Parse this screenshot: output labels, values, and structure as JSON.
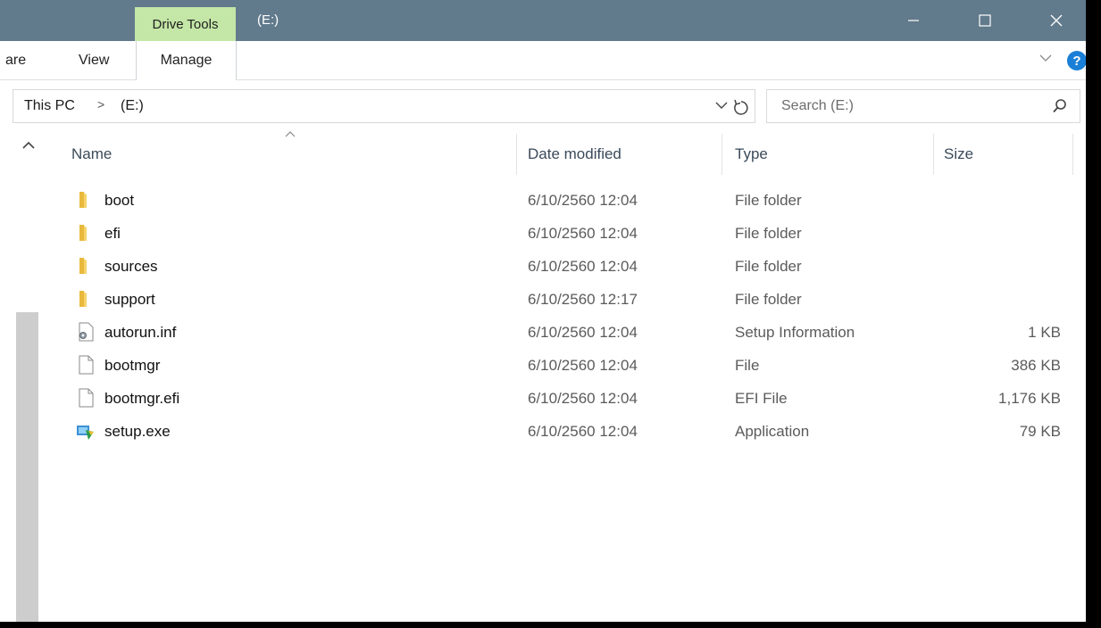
{
  "titlebar": {
    "context_tab": "Drive Tools",
    "title": "(E:)",
    "bg_color": "#617a8c",
    "context_color": "#c4e6a7"
  },
  "ribbon": {
    "tabs": [
      {
        "label": "are"
      },
      {
        "label": "View"
      },
      {
        "label": "Manage"
      }
    ]
  },
  "address": {
    "crumbs": [
      "This PC",
      "(E:)"
    ]
  },
  "search": {
    "placeholder": "Search (E:)"
  },
  "columns": {
    "name": "Name",
    "date": "Date modified",
    "type": "Type",
    "size": "Size"
  },
  "files": [
    {
      "name": "boot",
      "date": "6/10/2560 12:04",
      "type": "File folder",
      "size": "",
      "icon": "folder-icon"
    },
    {
      "name": "efi",
      "date": "6/10/2560 12:04",
      "type": "File folder",
      "size": "",
      "icon": "folder-icon"
    },
    {
      "name": "sources",
      "date": "6/10/2560 12:04",
      "type": "File folder",
      "size": "",
      "icon": "folder-icon"
    },
    {
      "name": "support",
      "date": "6/10/2560 12:17",
      "type": "File folder",
      "size": "",
      "icon": "folder-icon"
    },
    {
      "name": "autorun.inf",
      "date": "6/10/2560 12:04",
      "type": "Setup Information",
      "size": "1 KB",
      "icon": "setup-info-icon"
    },
    {
      "name": "bootmgr",
      "date": "6/10/2560 12:04",
      "type": "File",
      "size": "386 KB",
      "icon": "file-icon"
    },
    {
      "name": "bootmgr.efi",
      "date": "6/10/2560 12:04",
      "type": "EFI File",
      "size": "1,176 KB",
      "icon": "file-icon"
    },
    {
      "name": "setup.exe",
      "date": "6/10/2560 12:04",
      "type": "Application",
      "size": "79 KB",
      "icon": "setup-exe-icon"
    }
  ]
}
